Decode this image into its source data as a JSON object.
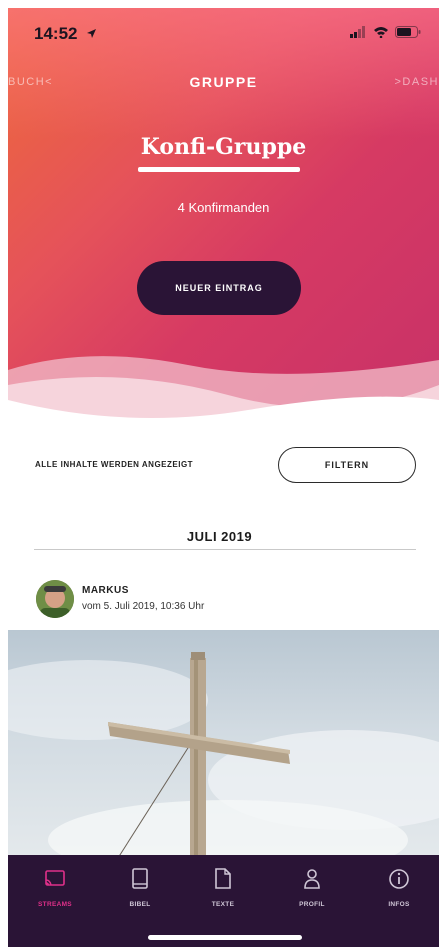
{
  "status_bar": {
    "time": "14:52"
  },
  "nav": {
    "left": "BUCH<",
    "title": "GRUPPE",
    "right": ">DASH"
  },
  "hero": {
    "group_title": "Konfi-Gruppe",
    "member_count": "4 Konfirmanden",
    "new_entry_label": "NEUER EINTRAG"
  },
  "filter": {
    "status_text": "ALLE INHALTE WERDEN ANGEZEIGT",
    "button_label": "FILTERN"
  },
  "feed": {
    "month": "JULI 2019",
    "post": {
      "author": "MARKUS",
      "date": "vom 5. Juli 2019, 10:36 Uhr"
    }
  },
  "tabbar": {
    "items": [
      {
        "label": "STREAMS",
        "icon": "cast-icon",
        "active": true
      },
      {
        "label": "BIBEL",
        "icon": "book-icon",
        "active": false
      },
      {
        "label": "TEXTE",
        "icon": "document-icon",
        "active": false
      },
      {
        "label": "PROFIL",
        "icon": "person-icon",
        "active": false
      },
      {
        "label": "INFOS",
        "icon": "info-icon",
        "active": false
      }
    ]
  },
  "colors": {
    "accent": "#e0308a",
    "dark": "#2a1436",
    "hero_start": "#ee6a3a",
    "hero_end": "#c73168"
  }
}
